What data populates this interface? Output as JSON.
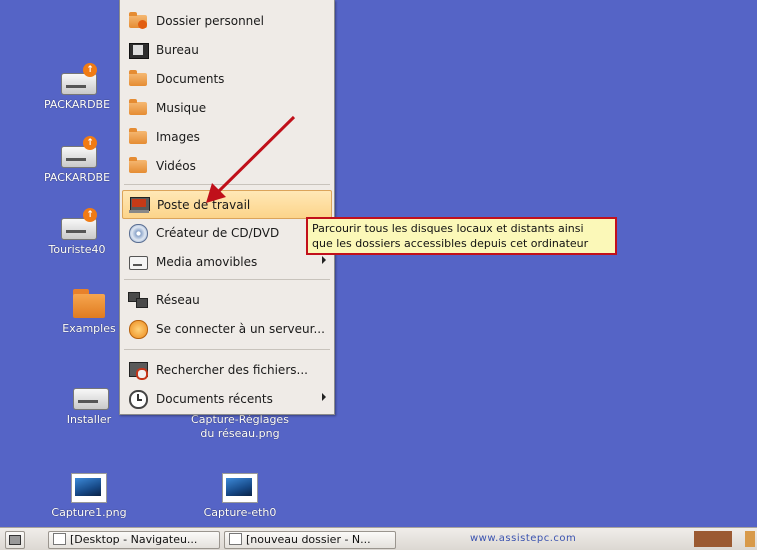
{
  "desktop": {
    "icons": [
      {
        "label": "PACKARDBE"
      },
      {
        "label": "PACKARDBE"
      },
      {
        "label": "Touriste40"
      },
      {
        "label": "Examples"
      },
      {
        "label": "Installer"
      },
      {
        "label": "Capture-Réglages du réseau.png"
      },
      {
        "label": "Capture1.png"
      },
      {
        "label": "Capture-eth0"
      }
    ]
  },
  "places_menu": {
    "items": [
      {
        "label": "Dossier personnel",
        "icon": "home-folder-icon"
      },
      {
        "label": "Bureau",
        "icon": "desktop-icon"
      },
      {
        "label": "Documents",
        "icon": "folder-icon"
      },
      {
        "label": "Musique",
        "icon": "folder-icon"
      },
      {
        "label": "Images",
        "icon": "folder-icon"
      },
      {
        "label": "Vidéos",
        "icon": "folder-icon"
      },
      {
        "label": "Poste de travail",
        "icon": "computer-icon"
      },
      {
        "label": "Créateur de CD/DVD",
        "icon": "cd-icon"
      },
      {
        "label": "Media amovibles",
        "icon": "drive-icon"
      },
      {
        "label": "Réseau",
        "icon": "network-icon"
      },
      {
        "label": "Se connecter à un serveur...",
        "icon": "connect-server-icon"
      },
      {
        "label": "Rechercher des fichiers...",
        "icon": "search-files-icon"
      },
      {
        "label": "Documents récents",
        "icon": "clock-icon"
      }
    ],
    "highlighted": "Poste de travail"
  },
  "tooltip": {
    "line1": "Parcourir tous les disques locaux et distants ainsi",
    "line2": "que les dossiers accessibles depuis cet ordinateur"
  },
  "taskbar": {
    "windows": [
      {
        "label": "[Desktop - Navigateu..."
      },
      {
        "label": "[nouveau dossier - N..."
      }
    ],
    "watermark": "www.assistepc.com"
  },
  "colors": {
    "desktop": "#5564c6",
    "menu_bg": "#efebe7",
    "highlight": "#fcd48a",
    "tooltip_bg": "#fbf8b8",
    "tooltip_border": "#c2101b",
    "arrow": "#c0101a"
  }
}
